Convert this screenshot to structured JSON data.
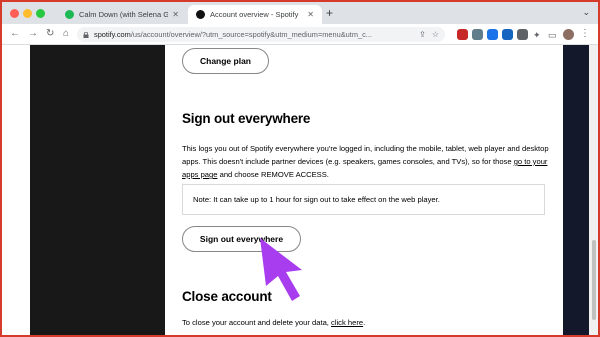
{
  "browser": {
    "tabs": [
      {
        "title": "Calm Down (with Selena Gome",
        "close": "✕"
      },
      {
        "title": "Account overview - Spotify",
        "close": "✕"
      }
    ],
    "new_tab": "+",
    "tab_menu": "⌄",
    "address": {
      "url_main": "spotify.com",
      "url_rest": "/us/account/overview/?utm_source=spotify&utm_medium=menu&utm_c..."
    }
  },
  "page": {
    "change_plan_label": "Change plan",
    "signout_section": {
      "title": "Sign out everywhere",
      "desc_before_link": "This logs you out of Spotify everywhere you're logged in, including the mobile, tablet, web player and desktop apps. This doesn't include partner devices (e.g. speakers, games consoles, and TVs), so for those ",
      "desc_link": "go to your apps page",
      "desc_after_link": " and choose REMOVE ACCESS.",
      "note": "Note: It can take up to 1 hour for sign out to take effect on the web player.",
      "button_label": "Sign out everywhere"
    },
    "close_section": {
      "title": "Close account",
      "desc_before_link": "To close your account and delete your data, ",
      "desc_link": "click here",
      "desc_after_link": "."
    }
  },
  "colors": {
    "frame_border": "#d63a2a",
    "annotation_arrow": "#a83df0",
    "spotify_green": "#1db954"
  },
  "icons": [
    "back-arrow-icon",
    "forward-arrow-icon",
    "reload-icon",
    "home-icon",
    "lock-icon",
    "share-icon",
    "star-icon",
    "puzzle-icon",
    "menu-dots-icon",
    "pointer-arrow-icon"
  ]
}
